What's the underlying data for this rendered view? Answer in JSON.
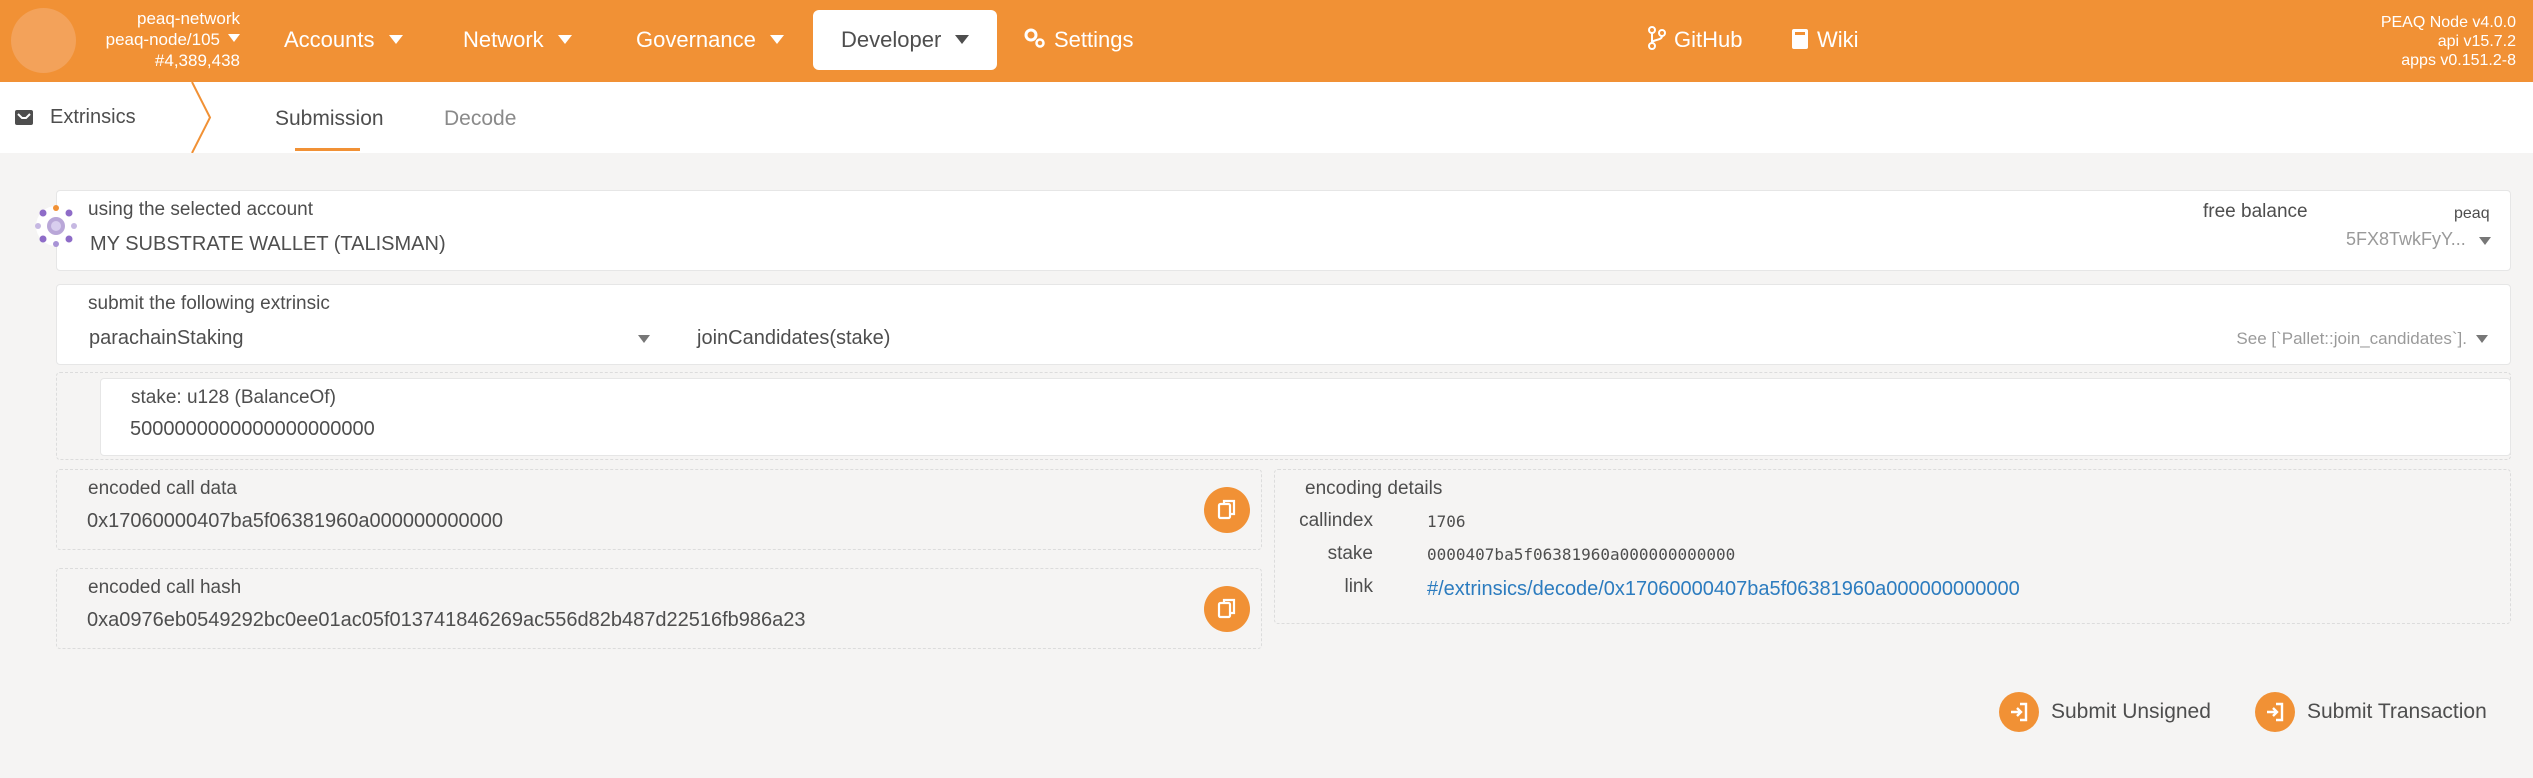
{
  "header": {
    "chain_name": "peaq-network",
    "node_name": "peaq-node/105",
    "block_number": "#4,389,438",
    "nav": {
      "accounts": "Accounts",
      "network": "Network",
      "governance": "Governance",
      "developer": "Developer",
      "settings": "Settings",
      "github": "GitHub",
      "wiki": "Wiki"
    },
    "version": {
      "node": "PEAQ Node v4.0.0",
      "api": "api v15.7.2",
      "apps": "apps v0.151.2-8"
    },
    "accent_color": "#f19135"
  },
  "tabs": {
    "section": "Extrinsics",
    "submission": "Submission",
    "decode": "Decode",
    "active": "Submission"
  },
  "account": {
    "label": "using the selected account",
    "name": "MY SUBSTRATE WALLET (TALISMAN)",
    "balance_label": "free balance",
    "token": "peaq",
    "address": "5FX8TwkFyY..."
  },
  "extrinsic": {
    "label": "submit the following extrinsic",
    "pallet": "parachainStaking",
    "method": "joinCandidates(stake)",
    "doc": "See [`Pallet::join_candidates`]."
  },
  "param": {
    "label": "stake: u128 (BalanceOf)",
    "value": "5000000000000000000000"
  },
  "encoded_call_data": {
    "label": "encoded call data",
    "value": "0x17060000407ba5f06381960a000000000000"
  },
  "encoded_call_hash": {
    "label": "encoded call hash",
    "value": "0xa0976eb0549292bc0ee01ac05f013741846269ac556d82b487d22516fb986a23"
  },
  "encoding_details": {
    "title": "encoding details",
    "callindex_label": "callindex",
    "callindex_value": "1706",
    "stake_label": "stake",
    "stake_value": "0000407ba5f06381960a000000000000",
    "link_label": "link",
    "link_value": "#/extrinsics/decode/0x17060000407ba5f06381960a000000000000"
  },
  "actions": {
    "submit_unsigned": "Submit Unsigned",
    "submit_transaction": "Submit Transaction"
  }
}
